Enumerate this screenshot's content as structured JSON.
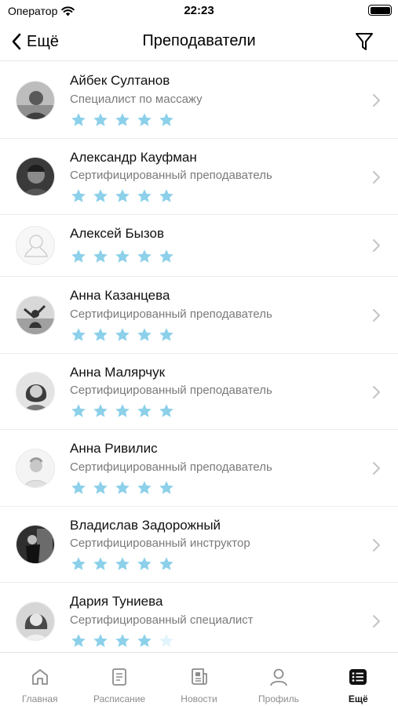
{
  "status_bar": {
    "carrier": "Оператор",
    "time": "22:23"
  },
  "nav": {
    "back_label": "Ещё",
    "title": "Преподаватели"
  },
  "colors": {
    "star_filled": "#8cd0ea",
    "star_empty": "#e2f4fb",
    "chevron": "#c4c4c4",
    "tab_inactive": "#8c8c8c",
    "tab_active": "#111111"
  },
  "teachers": [
    {
      "name": "Айбек Султанов",
      "role": "Специалист по массажу",
      "rating": 5,
      "avatar": "photo"
    },
    {
      "name": "Александр Кауфман",
      "role": "Сертифицированный преподаватель",
      "rating": 5,
      "avatar": "photo"
    },
    {
      "name": "Алексей Бызов",
      "role": "",
      "rating": 5,
      "avatar": "placeholder"
    },
    {
      "name": "Анна Казанцева",
      "role": "Сертифицированный преподаватель",
      "rating": 5,
      "avatar": "photo"
    },
    {
      "name": "Анна Малярчук",
      "role": "Сертифицированный преподаватель",
      "rating": 5,
      "avatar": "photo"
    },
    {
      "name": "Анна Ривилис",
      "role": "Сертифицированный преподаватель",
      "rating": 5,
      "avatar": "photo"
    },
    {
      "name": "Владислав Задорожный",
      "role": "Сертифицированный инструктор",
      "rating": 5,
      "avatar": "photo"
    },
    {
      "name": "Дария Туниева",
      "role": "Сертифицированный специалист",
      "rating": 4,
      "avatar": "photo"
    }
  ],
  "tabs": [
    {
      "label": "Главная",
      "icon": "home-icon",
      "active": false
    },
    {
      "label": "Расписание",
      "icon": "schedule-icon",
      "active": false
    },
    {
      "label": "Новости",
      "icon": "news-icon",
      "active": false
    },
    {
      "label": "Профиль",
      "icon": "profile-icon",
      "active": false
    },
    {
      "label": "Ещё",
      "icon": "more-icon",
      "active": true
    }
  ]
}
